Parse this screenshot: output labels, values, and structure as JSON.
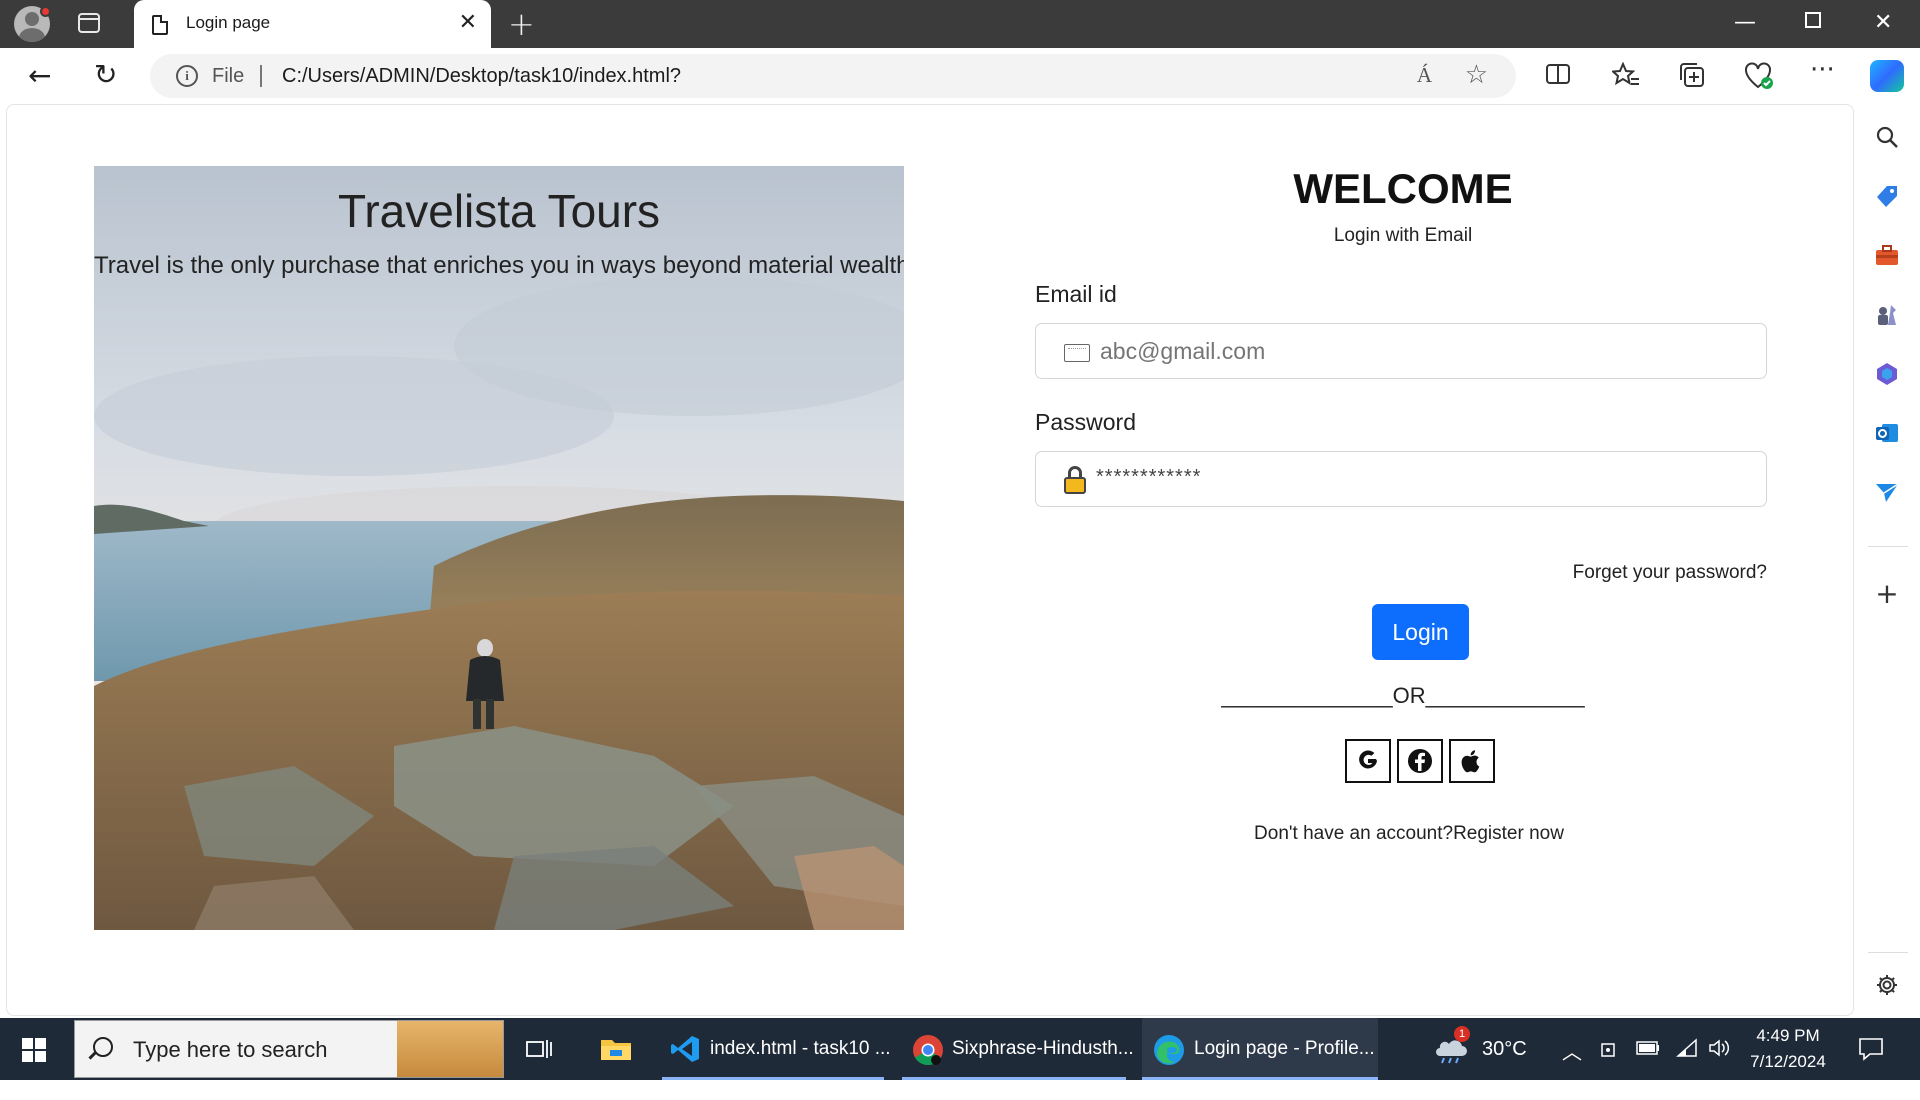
{
  "browser": {
    "tab_title": "Login page",
    "address_scheme": "File",
    "address_url": "C:/Users/ADMIN/Desktop/task10/index.html?",
    "read_aloud_label": "Á"
  },
  "hero": {
    "title": "Travelista Tours",
    "subtitle": "Travel is the only purchase that enriches you in ways beyond material wealth"
  },
  "form": {
    "heading": "WELCOME",
    "subheading": "Login with Email",
    "email_label": "Email id",
    "email_placeholder": "abc@gmail.com",
    "password_label": "Password",
    "password_value": "************",
    "forgot_link": "Forget your password?",
    "login_button": "Login",
    "or_divider": "______________OR_____________",
    "social_buttons": [
      "google-icon",
      "facebook-icon",
      "apple-icon"
    ],
    "register_prompt": "Don't have an account?",
    "register_link": "Register now",
    "primary_color": "#0d6efd"
  },
  "taskbar": {
    "search_placeholder": "Type here to search",
    "apps": [
      {
        "label": "index.html - task10 ...",
        "icon": "vscode-icon"
      },
      {
        "label": "Sixphrase-Hindusth...",
        "icon": "chrome-icon"
      },
      {
        "label": "Login page - Profile...",
        "icon": "edge-icon"
      }
    ],
    "weather": "30°C",
    "notification_count": "1",
    "time": "4:49 PM",
    "date": "7/12/2024"
  }
}
